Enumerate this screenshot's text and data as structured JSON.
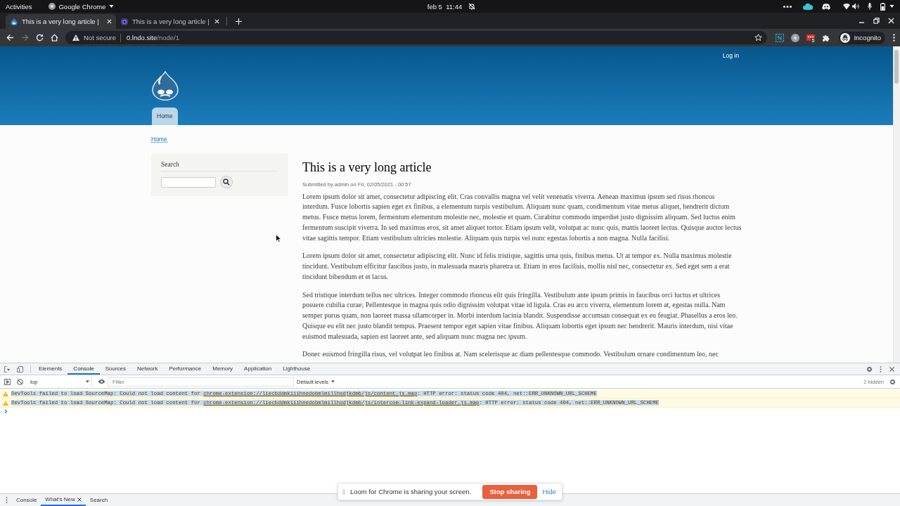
{
  "system_bar": {
    "activities": "Activities",
    "app_name": "Google Chrome",
    "date": "feb 5",
    "time": "11:44"
  },
  "browser": {
    "tabs": [
      {
        "title": "This is a very long article |",
        "selected": true,
        "kind": "drop"
      },
      {
        "title": "This is a very long article |",
        "selected": false,
        "kind": "cog"
      }
    ],
    "nav_buttons": [
      {
        "kind": "back",
        "disabled": false
      },
      {
        "kind": "forward",
        "disabled": true
      },
      {
        "kind": "reload",
        "disabled": false
      },
      {
        "kind": "home",
        "disabled": false
      }
    ],
    "address": {
      "security": "Not secure",
      "host": "0.lndo.site",
      "path": "/node/1"
    },
    "extension_badge": "5",
    "profile": "Incognito"
  },
  "page": {
    "login": "Log in",
    "main_menu": [
      {
        "label": "Home",
        "selected": true
      }
    ],
    "breadcrumb": [
      "Home"
    ],
    "search_block": {
      "title": "Search"
    },
    "article": {
      "title": "This is a very long article",
      "meta": "Submitted by admin on Fri, 02/05/2021 - 00:57",
      "paragraphs": [
        "Lorem ipsum dolor sit amet, consectetur adipiscing elit. Cras convallis magna vel velit venenatis viverra. Aenean maximus ipsum sed risus rhoncus interdum. Fusce lobortis sapien eget ex finibus, a elementum turpis vestibulum. Aliquam nunc quam, condimentum vitae metus aliquet, hendrerit dictum metus. Fusce metus lorem, fermentum elementum molestie nec, molestie et quam. Curabitur commodo imperdiet justo dignissim aliquam. Sed luctus enim fermentum suscipit viverra. In sed maximus eros, sit amet aliquet tortor. Etiam ipsum velit, volutpat ac nunc quis, mattis laoreet lectus. Quisque auctor lectus vitae sagittis tempor. Etiam vestibulum ultricies molestie. Aliquam quis turpis vel nunc egestas lobortis a non magna. Nulla facilisi.",
        "Lorem ipsum dolor sit amet, consectetur adipiscing elit. Nunc id felis tristique, sagittis urna quis, finibus metus. Ut at tempor ex. Nulla maximus molestie tincidunt. Vestibulum efficitur faucibus justo, in malesuada mauris pharetra ut. Etiam in eros facilisis, mollis nisl nec, consectetur ex. Sed eget sem a erat tincidunt bibendum et et lacus.",
        "Sed tristique interdum tellus nec ultrices. Integer commodo rhoncus elit quis fringilla. Vestibulum ante ipsum primis in faucibus orci luctus et ultrices posuere cubilia curae; Pellentesque in magna quis odio dignissim volutpat vitae id ligula. Cras eu arcu viverra, elementum lorem at, egestas nulla. Nam semper purus quam, non laoreet massa ullamcorper in. Morbi interdum lacinia blandit. Suspendisse accumsan consequat ex eu feugiat. Phasellus a eros leo. Quisque eu elit nec justo blandit tempus. Praesent tempor eget sapien vitae finibus. Aliquam lobortis eget ipsum nec hendrerit. Mauris interdum, nisi vitae euismod malesuada, sapien est laoreet ante, sed aliquam nunc magna nec ipsum.",
        "Donec euismod fringilla risus, vel volutpat leo finibus at. Nam scelerisque ac diam pellentesque commodo. Vestibulum ornare condimentum leo, nec"
      ]
    }
  },
  "devtools": {
    "tabs": [
      {
        "label": "Elements",
        "selected": false
      },
      {
        "label": "Console",
        "selected": true
      },
      {
        "label": "Sources",
        "selected": false
      },
      {
        "label": "Network",
        "selected": false
      },
      {
        "label": "Performance",
        "selected": false
      },
      {
        "label": "Memory",
        "selected": false
      },
      {
        "label": "Application",
        "selected": false
      },
      {
        "label": "Lighthouse",
        "selected": false
      }
    ],
    "context": "top",
    "filter_placeholder": "Filter",
    "levels": "Default levels",
    "hidden": "2 hidden",
    "messages": [
      {
        "kind": "warning",
        "selected": true,
        "text": "DevTools failed to load SourceMap: Could not load content for ",
        "link": "chrome-extension://liecbddmkiiihnedobmlmillhodjkdmb/js/content.js.map",
        "suffix": ": HTTP error: status code 404, net::ERR_UNKNOWN_URL_SCHEME"
      },
      {
        "kind": "warning",
        "selected": true,
        "text": "DevTools failed to load SourceMap: Could not load content for ",
        "link": "chrome-extension://liecbddmkiiihnedobmlmillhodjkdmb/js/intercom-link-expand-loader.js.map",
        "suffix": ": HTTP error: status code 404, net::ERR_UNKNOWN_URL_SCHEME"
      }
    ],
    "drawer_tabs": [
      {
        "label": "Console",
        "selected": false,
        "closable": false
      },
      {
        "label": "What's New",
        "selected": true,
        "closable": true
      },
      {
        "label": "Search",
        "selected": false,
        "closable": false
      }
    ]
  },
  "loom": {
    "message": "Loom for Chrome is sharing your screen.",
    "stop_button": "Stop sharing",
    "hide_button": "Hide"
  }
}
